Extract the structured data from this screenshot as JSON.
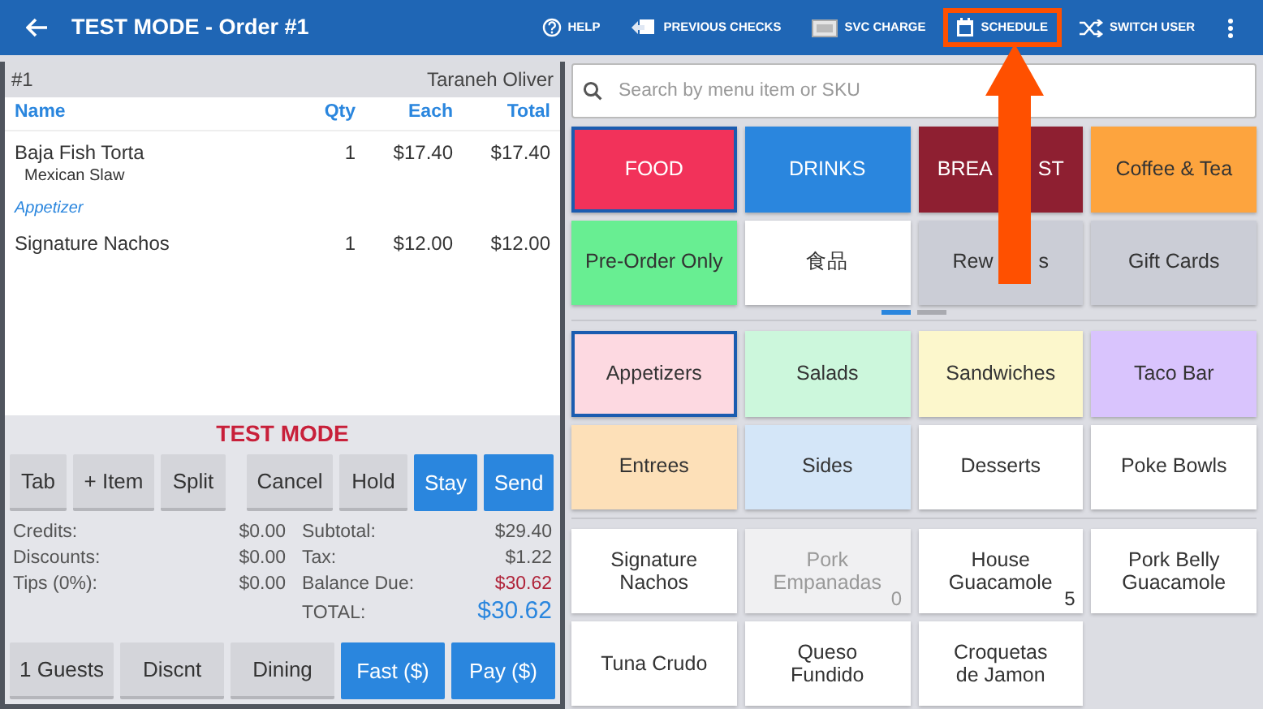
{
  "header": {
    "title": "TEST MODE - Order #1",
    "actions": [
      {
        "label": "HELP",
        "highlighted": false
      },
      {
        "label": "PREVIOUS CHECKS",
        "highlighted": false
      },
      {
        "label": "SVC CHARGE",
        "highlighted": false
      },
      {
        "label": "SCHEDULE",
        "highlighted": true
      },
      {
        "label": "SWITCH USER",
        "highlighted": false
      }
    ]
  },
  "order": {
    "number": "#1",
    "customer": "Taraneh Oliver",
    "columns": [
      "Name",
      "Qty",
      "Each",
      "Total"
    ],
    "lines": [
      {
        "kind": "item",
        "name": "Baja Fish Torta",
        "modifier": "Mexican Slaw",
        "qty": "1",
        "each": "$17.40",
        "total": "$17.40"
      },
      {
        "kind": "course",
        "label": "Appetizer"
      },
      {
        "kind": "item",
        "name": "Signature Nachos",
        "qty": "1",
        "each": "$12.00",
        "total": "$12.00"
      }
    ]
  },
  "banner": "TEST MODE",
  "action_buttons": [
    {
      "label": "Tab",
      "primary": false
    },
    {
      "label": "+ Item",
      "primary": false
    },
    {
      "label": "Split",
      "primary": false
    },
    {
      "label": "Cancel",
      "primary": false
    },
    {
      "label": "Hold",
      "primary": false
    },
    {
      "label": "Stay",
      "primary": true
    },
    {
      "label": "Send",
      "primary": true
    }
  ],
  "summary_left": [
    {
      "label": "Credits:",
      "value": "$0.00"
    },
    {
      "label": "Discounts:",
      "value": "$0.00"
    },
    {
      "label": "Tips (0%):",
      "value": "$0.00"
    }
  ],
  "summary_right": [
    {
      "label": "Subtotal:",
      "value": "$29.40",
      "kind": "plain"
    },
    {
      "label": "Tax:",
      "value": "$1.22",
      "kind": "plain"
    },
    {
      "label": "Balance Due:",
      "value": "$30.62",
      "kind": "due"
    },
    {
      "label": "TOTAL:",
      "value": "$30.62",
      "kind": "total"
    }
  ],
  "bottom_buttons": [
    {
      "label": "1 Guests",
      "primary": false
    },
    {
      "label": "Discnt",
      "primary": false
    },
    {
      "label": "Dining",
      "primary": false
    },
    {
      "label": "Fast ($)",
      "primary": true
    },
    {
      "label": "Pay ($)",
      "primary": true
    }
  ],
  "search": {
    "placeholder": "Search by menu item or SKU"
  },
  "categories": [
    {
      "label_parts": [
        "FOOD"
      ],
      "color": "#f2325a",
      "selected": true
    },
    {
      "label_parts": [
        "DRINKS"
      ],
      "color": "#2a86de",
      "selected": false
    },
    {
      "label_parts": [
        "BREA",
        "ST"
      ],
      "color": "#8e1f31",
      "selected": false
    },
    {
      "label_parts": [
        "Coffee & Tea"
      ],
      "color": "#fda43e",
      "selected": false
    },
    {
      "label_parts": [
        "Pre-Order Only"
      ],
      "color": "#68ee92",
      "selected": false
    },
    {
      "label_parts": [
        "食品"
      ],
      "color": "#ffffff",
      "selected": false
    },
    {
      "label_parts": [
        "Rew",
        "s"
      ],
      "color": "#cbcdd6",
      "selected": false
    },
    {
      "label_parts": [
        "Gift Cards"
      ],
      "color": "#cbcdd6",
      "selected": false
    }
  ],
  "page_dots": [
    {
      "selected": true
    },
    {
      "selected": false
    }
  ],
  "subcategories": [
    {
      "label": "Appetizers",
      "color": "#fdd9e1",
      "selected": true
    },
    {
      "label": "Salads",
      "color": "#ccf7dc",
      "selected": false
    },
    {
      "label": "Sandwiches",
      "color": "#fcf7cc",
      "selected": false
    },
    {
      "label": "Taco Bar",
      "color": "#d9c4fd",
      "selected": false
    },
    {
      "label": "Entrees",
      "color": "#fde0b8",
      "selected": false
    },
    {
      "label": "Sides",
      "color": "#d4e6f8",
      "selected": false
    },
    {
      "label": "Desserts",
      "color": "#ffffff",
      "selected": false
    },
    {
      "label": "Poke Bowls",
      "color": "#ffffff",
      "selected": false
    }
  ],
  "items": [
    {
      "label": "Signature Nachos",
      "disabled": false
    },
    {
      "label": "Pork Empanadas",
      "count": "0",
      "disabled": true
    },
    {
      "label": "House Guacamole",
      "count": "5",
      "disabled": false
    },
    {
      "label": "Pork Belly Guacamole",
      "disabled": false
    },
    {
      "label": "Tuna Crudo",
      "disabled": false
    },
    {
      "label": "Queso Fundido",
      "disabled": false
    },
    {
      "label": "Croquetas de Jamon",
      "disabled": false
    }
  ]
}
